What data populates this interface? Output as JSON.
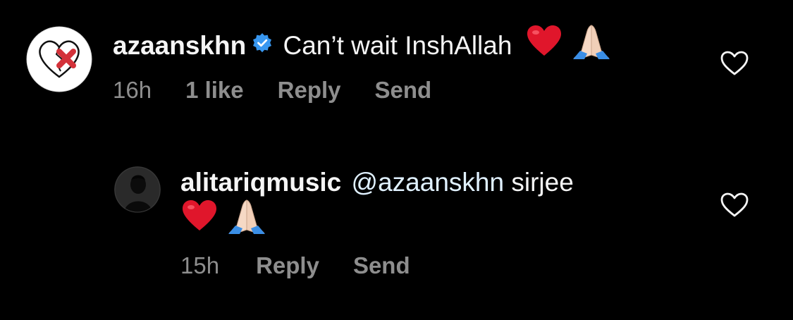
{
  "comments": [
    {
      "username": "azaanskhn",
      "verified": true,
      "text": "Can’t wait InshAllah",
      "emojis": [
        "red-heart",
        "folded-hands"
      ],
      "time": "16h",
      "likes": "1 like",
      "reply_label": "Reply",
      "send_label": "Send"
    },
    {
      "username": "alitariqmusic",
      "mention": "@azaanskhn",
      "text": "sirjee",
      "emojis": [
        "red-heart",
        "folded-hands"
      ],
      "time": "15h",
      "reply_label": "Reply",
      "send_label": "Send"
    }
  ],
  "colors": {
    "background": "#000000",
    "primary_text": "#f5f5f5",
    "secondary_text": "#8e8e8e",
    "mention": "#e0f1ff",
    "verified_badge": "#3897f0",
    "heart_red": "#e0162b"
  }
}
